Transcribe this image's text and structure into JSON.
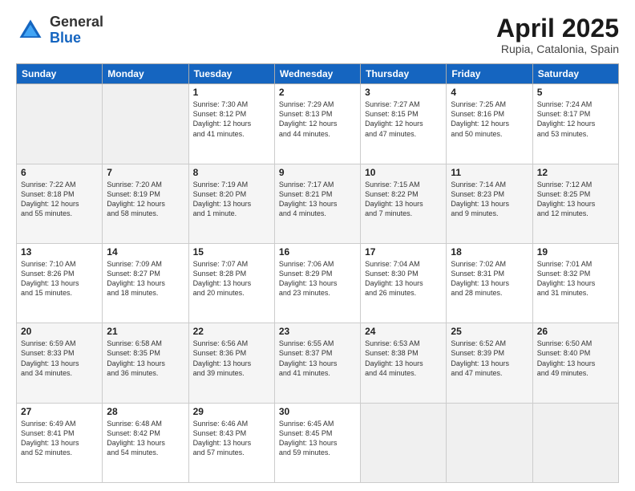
{
  "header": {
    "logo_general": "General",
    "logo_blue": "Blue",
    "title": "April 2025",
    "location": "Rupia, Catalonia, Spain"
  },
  "days_of_week": [
    "Sunday",
    "Monday",
    "Tuesday",
    "Wednesday",
    "Thursday",
    "Friday",
    "Saturday"
  ],
  "weeks": [
    [
      {
        "day": "",
        "lines": [],
        "empty": true
      },
      {
        "day": "",
        "lines": [],
        "empty": true
      },
      {
        "day": "1",
        "lines": [
          "Sunrise: 7:30 AM",
          "Sunset: 8:12 PM",
          "Daylight: 12 hours",
          "and 41 minutes."
        ]
      },
      {
        "day": "2",
        "lines": [
          "Sunrise: 7:29 AM",
          "Sunset: 8:13 PM",
          "Daylight: 12 hours",
          "and 44 minutes."
        ]
      },
      {
        "day": "3",
        "lines": [
          "Sunrise: 7:27 AM",
          "Sunset: 8:15 PM",
          "Daylight: 12 hours",
          "and 47 minutes."
        ]
      },
      {
        "day": "4",
        "lines": [
          "Sunrise: 7:25 AM",
          "Sunset: 8:16 PM",
          "Daylight: 12 hours",
          "and 50 minutes."
        ]
      },
      {
        "day": "5",
        "lines": [
          "Sunrise: 7:24 AM",
          "Sunset: 8:17 PM",
          "Daylight: 12 hours",
          "and 53 minutes."
        ]
      }
    ],
    [
      {
        "day": "6",
        "lines": [
          "Sunrise: 7:22 AM",
          "Sunset: 8:18 PM",
          "Daylight: 12 hours",
          "and 55 minutes."
        ]
      },
      {
        "day": "7",
        "lines": [
          "Sunrise: 7:20 AM",
          "Sunset: 8:19 PM",
          "Daylight: 12 hours",
          "and 58 minutes."
        ]
      },
      {
        "day": "8",
        "lines": [
          "Sunrise: 7:19 AM",
          "Sunset: 8:20 PM",
          "Daylight: 13 hours",
          "and 1 minute."
        ]
      },
      {
        "day": "9",
        "lines": [
          "Sunrise: 7:17 AM",
          "Sunset: 8:21 PM",
          "Daylight: 13 hours",
          "and 4 minutes."
        ]
      },
      {
        "day": "10",
        "lines": [
          "Sunrise: 7:15 AM",
          "Sunset: 8:22 PM",
          "Daylight: 13 hours",
          "and 7 minutes."
        ]
      },
      {
        "day": "11",
        "lines": [
          "Sunrise: 7:14 AM",
          "Sunset: 8:23 PM",
          "Daylight: 13 hours",
          "and 9 minutes."
        ]
      },
      {
        "day": "12",
        "lines": [
          "Sunrise: 7:12 AM",
          "Sunset: 8:25 PM",
          "Daylight: 13 hours",
          "and 12 minutes."
        ]
      }
    ],
    [
      {
        "day": "13",
        "lines": [
          "Sunrise: 7:10 AM",
          "Sunset: 8:26 PM",
          "Daylight: 13 hours",
          "and 15 minutes."
        ]
      },
      {
        "day": "14",
        "lines": [
          "Sunrise: 7:09 AM",
          "Sunset: 8:27 PM",
          "Daylight: 13 hours",
          "and 18 minutes."
        ]
      },
      {
        "day": "15",
        "lines": [
          "Sunrise: 7:07 AM",
          "Sunset: 8:28 PM",
          "Daylight: 13 hours",
          "and 20 minutes."
        ]
      },
      {
        "day": "16",
        "lines": [
          "Sunrise: 7:06 AM",
          "Sunset: 8:29 PM",
          "Daylight: 13 hours",
          "and 23 minutes."
        ]
      },
      {
        "day": "17",
        "lines": [
          "Sunrise: 7:04 AM",
          "Sunset: 8:30 PM",
          "Daylight: 13 hours",
          "and 26 minutes."
        ]
      },
      {
        "day": "18",
        "lines": [
          "Sunrise: 7:02 AM",
          "Sunset: 8:31 PM",
          "Daylight: 13 hours",
          "and 28 minutes."
        ]
      },
      {
        "day": "19",
        "lines": [
          "Sunrise: 7:01 AM",
          "Sunset: 8:32 PM",
          "Daylight: 13 hours",
          "and 31 minutes."
        ]
      }
    ],
    [
      {
        "day": "20",
        "lines": [
          "Sunrise: 6:59 AM",
          "Sunset: 8:33 PM",
          "Daylight: 13 hours",
          "and 34 minutes."
        ]
      },
      {
        "day": "21",
        "lines": [
          "Sunrise: 6:58 AM",
          "Sunset: 8:35 PM",
          "Daylight: 13 hours",
          "and 36 minutes."
        ]
      },
      {
        "day": "22",
        "lines": [
          "Sunrise: 6:56 AM",
          "Sunset: 8:36 PM",
          "Daylight: 13 hours",
          "and 39 minutes."
        ]
      },
      {
        "day": "23",
        "lines": [
          "Sunrise: 6:55 AM",
          "Sunset: 8:37 PM",
          "Daylight: 13 hours",
          "and 41 minutes."
        ]
      },
      {
        "day": "24",
        "lines": [
          "Sunrise: 6:53 AM",
          "Sunset: 8:38 PM",
          "Daylight: 13 hours",
          "and 44 minutes."
        ]
      },
      {
        "day": "25",
        "lines": [
          "Sunrise: 6:52 AM",
          "Sunset: 8:39 PM",
          "Daylight: 13 hours",
          "and 47 minutes."
        ]
      },
      {
        "day": "26",
        "lines": [
          "Sunrise: 6:50 AM",
          "Sunset: 8:40 PM",
          "Daylight: 13 hours",
          "and 49 minutes."
        ]
      }
    ],
    [
      {
        "day": "27",
        "lines": [
          "Sunrise: 6:49 AM",
          "Sunset: 8:41 PM",
          "Daylight: 13 hours",
          "and 52 minutes."
        ]
      },
      {
        "day": "28",
        "lines": [
          "Sunrise: 6:48 AM",
          "Sunset: 8:42 PM",
          "Daylight: 13 hours",
          "and 54 minutes."
        ]
      },
      {
        "day": "29",
        "lines": [
          "Sunrise: 6:46 AM",
          "Sunset: 8:43 PM",
          "Daylight: 13 hours",
          "and 57 minutes."
        ]
      },
      {
        "day": "30",
        "lines": [
          "Sunrise: 6:45 AM",
          "Sunset: 8:45 PM",
          "Daylight: 13 hours",
          "and 59 minutes."
        ]
      },
      {
        "day": "",
        "lines": [],
        "empty": true
      },
      {
        "day": "",
        "lines": [],
        "empty": true
      },
      {
        "day": "",
        "lines": [],
        "empty": true
      }
    ]
  ]
}
